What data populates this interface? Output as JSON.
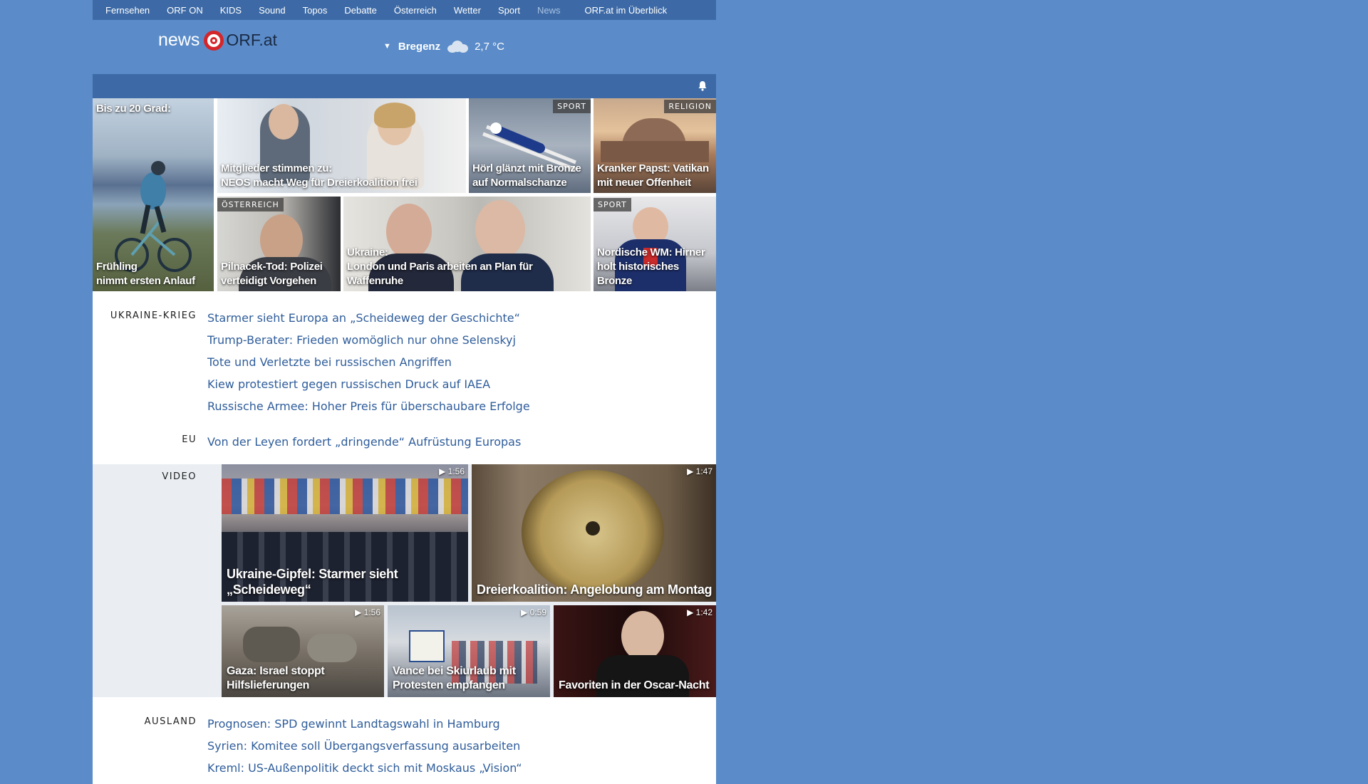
{
  "topnav": {
    "items": [
      "Fernsehen",
      "ORF ON",
      "KIDS",
      "Sound",
      "Topos",
      "Debatte",
      "Österreich",
      "Wetter",
      "Sport",
      "News"
    ],
    "overview": "ORF.at im Überblick"
  },
  "header": {
    "logo_news": "news",
    "logo_orf": "ORF.at",
    "weather_location": "Bregenz",
    "weather_temp": "2,7 °C"
  },
  "teasers": {
    "t1_top": "Bis zu 20 Grad:",
    "t1_caption1": "Frühling",
    "t1_caption2": "nimmt ersten Anlauf",
    "t2_caption1": "Mitglieder stimmen zu:",
    "t2_caption2": "NEOS macht Weg für Dreierkoalition frei",
    "t3_tag": "SPORT",
    "t3_caption1": "Hörl glänzt mit Bronze",
    "t3_caption2": "auf Normalschanze",
    "t4_tag": "RELIGION",
    "t4_caption1": "Kranker Papst: Vatikan",
    "t4_caption2": "mit neuer Offenheit",
    "t5_tag": "ÖSTERREICH",
    "t5_caption1": "Pilnacek-Tod: Polizei",
    "t5_caption2": "verteidigt Vorgehen",
    "t6_caption1": "Ukraine:",
    "t6_caption2": "London und Paris arbeiten an Plan für Waffenruhe",
    "t7_tag": "SPORT",
    "t7_caption1": "Nordische WM: Hirner",
    "t7_caption2": "holt historisches Bronze"
  },
  "sections": {
    "ukraine": {
      "label": "UKRAINE-KRIEG",
      "items": [
        "Starmer sieht Europa an „Scheideweg der Geschichte“",
        "Trump-Berater: Frieden womöglich nur ohne Selenskyj",
        "Tote und Verletzte bei russischen Angriffen",
        "Kiew protestiert gegen russischen Druck auf IAEA",
        "Russische Armee: Hoher Preis für überschaubare Erfolge"
      ]
    },
    "eu": {
      "label": "EU",
      "items": [
        "Von der Leyen fordert „dringende“ Aufrüstung Europas"
      ]
    },
    "ausland": {
      "label": "AUSLAND",
      "items": [
        "Prognosen: SPD gewinnt Landtagswahl in Hamburg",
        "Syrien: Komitee soll Übergangsverfassung ausarbeiten",
        "Kreml: US-Außenpolitik deckt sich mit Moskaus „Vision“"
      ]
    }
  },
  "video": {
    "label": "VIDEO",
    "v1": {
      "duration": "1:56",
      "caption1": "Ukraine-Gipfel: Starmer sieht",
      "caption2": "„Scheideweg“"
    },
    "v2": {
      "duration": "1:47",
      "caption1": "Dreierkoalition: Angelobung am Montag"
    },
    "v3": {
      "duration": "1:56",
      "caption1": "Gaza: Israel stoppt",
      "caption2": "Hilfslieferungen"
    },
    "v4": {
      "duration": "0:59",
      "caption1": "Vance bei Skiurlaub mit",
      "caption2": "Protesten empfangen"
    },
    "v5": {
      "duration": "1:42",
      "caption1": "Favoriten in der Oscar-Nacht"
    }
  },
  "colors": {
    "page_bg": "#5b8cc9",
    "nav_bg": "#3d6aa6",
    "link": "#2f5d9b",
    "logo_red": "#d4262a"
  },
  "icons": [
    "bell-icon",
    "cloud-icon",
    "play-icon",
    "chevron-down-icon"
  ]
}
